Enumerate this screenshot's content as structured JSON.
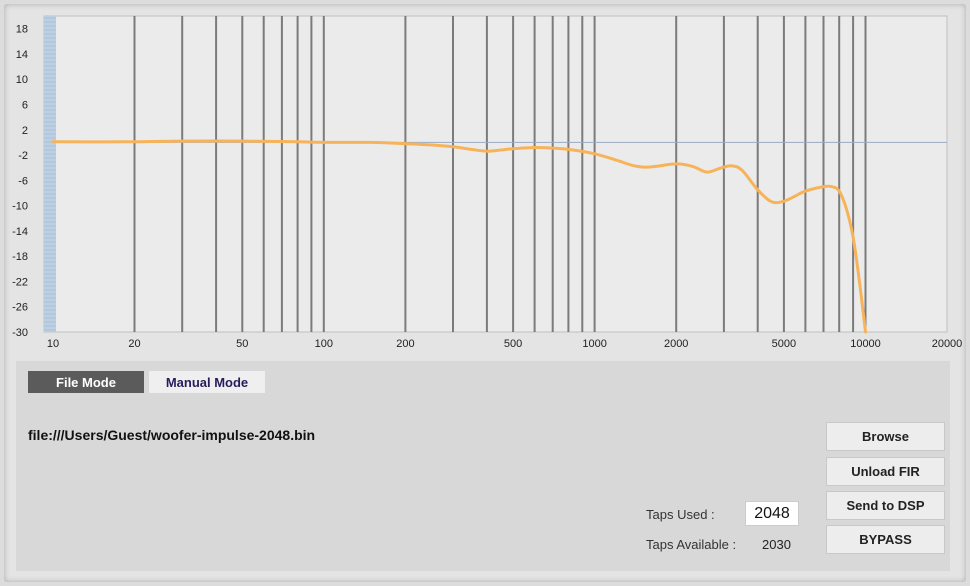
{
  "chart_data": {
    "type": "line",
    "x_scale": "log",
    "xlim": [
      10,
      20000
    ],
    "ylim": [
      -30,
      20
    ],
    "x_ticks": [
      "10",
      "20",
      "50",
      "100",
      "200",
      "500",
      "1000",
      "2000",
      "5000",
      "10000",
      "20000"
    ],
    "y_ticks": [
      "18",
      "14",
      "10",
      "6",
      "2",
      "-2",
      "-6",
      "-10",
      "-14",
      "-18",
      "-22",
      "-26",
      "-30"
    ],
    "grid_markers_hz": [
      20,
      30,
      40,
      50,
      60,
      70,
      80,
      90,
      100,
      200,
      300,
      400,
      500,
      600,
      700,
      800,
      900,
      1000,
      2000,
      3000,
      4000,
      5000,
      6000,
      7000,
      8000,
      9000,
      10000
    ],
    "reference_level": 0,
    "series": [
      {
        "color": "#f7b35a",
        "x": [
          10,
          20,
          30,
          50,
          80,
          100,
          150,
          200,
          250,
          300,
          350,
          400,
          450,
          500,
          600,
          700,
          800,
          1000,
          1200,
          1400,
          1600,
          2000,
          2300,
          2600,
          2900,
          3200,
          3500,
          4000,
          4500,
          5000,
          5500,
          6000,
          7000,
          7500,
          8000,
          8500,
          9000,
          9500,
          10000
        ],
        "y": [
          0.1,
          0.1,
          0.2,
          0.2,
          0.1,
          0,
          0,
          -0.2,
          -0.4,
          -0.7,
          -1.1,
          -1.4,
          -1.2,
          -1,
          -0.8,
          -0.9,
          -1.1,
          -1.8,
          -2.8,
          -3.7,
          -3.9,
          -3.4,
          -3.8,
          -4.7,
          -4.1,
          -3.7,
          -4.4,
          -7.5,
          -9.4,
          -9.3,
          -8.5,
          -7.7,
          -7,
          -7,
          -7.7,
          -10.5,
          -15,
          -22,
          -30
        ]
      }
    ]
  },
  "colors": {
    "curve": "#f7b35a",
    "grid_marker": "#7b7b7b",
    "reference_line": "#9aabbf",
    "y_axis_strip": "#bdd0e2",
    "active_tab": "#5b5b5b"
  },
  "tabs": {
    "file_mode": "File Mode",
    "manual_mode": "Manual Mode"
  },
  "file": {
    "path": "file:///Users/Guest/woofer-impulse-2048.bin"
  },
  "buttons": {
    "browse": "Browse",
    "unload": "Unload FIR",
    "send": "Send to DSP",
    "bypass": "BYPASS"
  },
  "taps": {
    "used_label": "Taps Used :",
    "used_value": "2048",
    "available_label": "Taps Available :",
    "available_value": "2030"
  }
}
